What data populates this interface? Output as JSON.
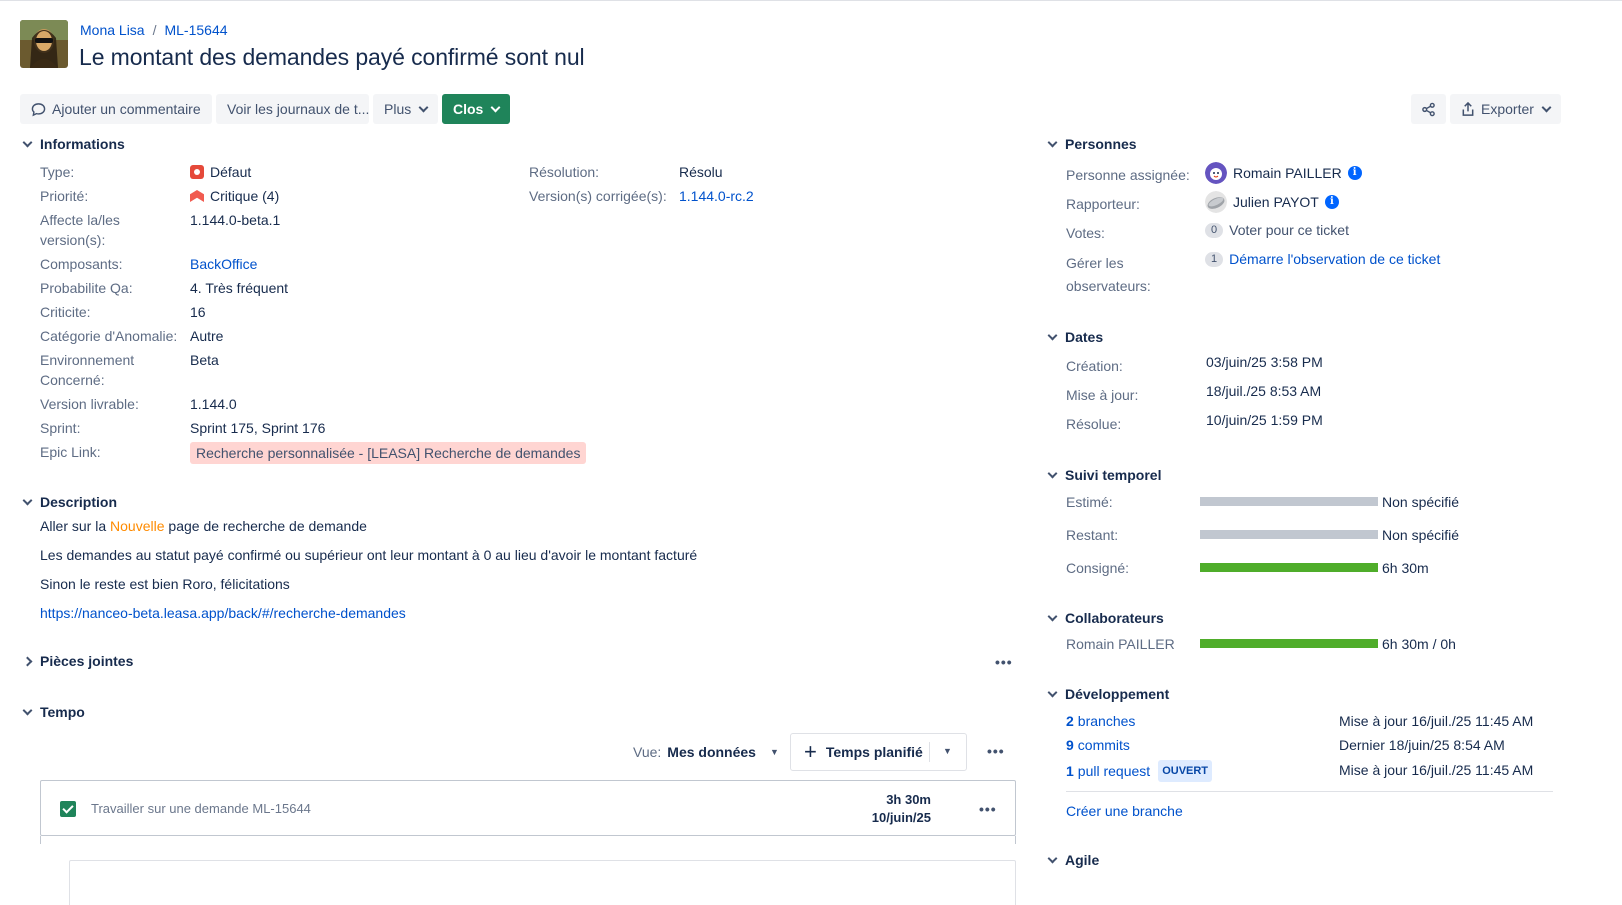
{
  "header": {
    "project": "Mona Lisa",
    "issue_key": "ML-15644",
    "title": "Le montant des demandes payé confirmé sont nul"
  },
  "toolbar": {
    "comment": "Ajouter un commentaire",
    "logs": "Voir les journaux de t...",
    "more": "Plus",
    "status": "Clos",
    "export": "Exporter"
  },
  "details": {
    "heading": "Informations",
    "type_label": "Type:",
    "type_value": "Défaut",
    "priority_label": "Priorité:",
    "priority_value": "Critique (4)",
    "affects_label": "Affecte la/les version(s):",
    "affects_value": "1.144.0-beta.1",
    "components_label": "Composants:",
    "components_value": "BackOffice",
    "proba_label": "Probabilite Qa:",
    "proba_value": "4. Très fréquent",
    "criticite_label": "Criticite:",
    "criticite_value": "16",
    "category_label": "Catégorie d'Anomalie:",
    "category_value": "Autre",
    "env_label": "Environnement Concerné:",
    "env_value": "Beta",
    "release_label": "Version livrable:",
    "release_value": "1.144.0",
    "sprint_label": "Sprint:",
    "sprint_value": "Sprint 175, Sprint 176",
    "epic_label": "Epic Link:",
    "epic_value": "Recherche personnalisée - [LEASA] Recherche de demandes",
    "resolution_label": "Résolution:",
    "resolution_value": "Résolu",
    "fix_label": "Version(s) corrigée(s):",
    "fix_value": "1.144.0-rc.2"
  },
  "description": {
    "heading": "Description",
    "line1_pre": "Aller sur la ",
    "line1_word": "Nouvelle",
    "line1_post": " page de recherche de demande",
    "line2": "Les demandes au statut payé confirmé ou supérieur ont leur montant à 0 au lieu d'avoir le montant facturé",
    "line3": "Sinon le reste est bien Roro, félicitations",
    "link": "https://nanceo-beta.leasa.app/back/#/recherche-demandes"
  },
  "attachments": {
    "heading": "Pièces jointes"
  },
  "tempo": {
    "heading": "Tempo",
    "view_label": "Vue:",
    "view_value": "Mes données",
    "planned": "Temps planifié",
    "worklog_desc": "Travailler sur une demande ML-15644",
    "worklog_time": "3h 30m",
    "worklog_date": "10/juin/25"
  },
  "people": {
    "heading": "Personnes",
    "assignee_label": "Personne assignée:",
    "assignee": "Romain PAILLER",
    "reporter_label": "Rapporteur:",
    "reporter": "Julien PAYOT",
    "votes_label": "Votes:",
    "votes_count": "0",
    "votes_link": "Voter pour ce ticket",
    "watchers_label": "Gérer les observateurs:",
    "watchers_count": "1",
    "watchers_link": "Démarre l'observation de ce ticket"
  },
  "dates": {
    "heading": "Dates",
    "created_label": "Création:",
    "created": "03/juin/25 3:58 PM",
    "updated_label": "Mise à jour:",
    "updated": "18/juil./25 8:53 AM",
    "resolved_label": "Résolue:",
    "resolved": "10/juin/25 1:59 PM"
  },
  "time_tracking": {
    "heading": "Suivi temporel",
    "estimated_label": "Estimé:",
    "estimated": "Non spécifié",
    "remaining_label": "Restant:",
    "remaining": "Non spécifié",
    "logged_label": "Consigné:",
    "logged": "6h 30m",
    "logged_fraction": 1.0
  },
  "collaborators": {
    "heading": "Collaborateurs",
    "name": "Romain PAILLER",
    "value": "6h 30m / 0h",
    "fraction": 1.0
  },
  "development": {
    "heading": "Développement",
    "branches_count": "2",
    "branches_label": "branches",
    "branches_status": "Mise à jour 16/juil./25 11:45 AM",
    "commits_count": "9",
    "commits_label": "commits",
    "commits_status": "Dernier 18/juin/25 8:54 AM",
    "pr_count": "1",
    "pr_label": "pull request",
    "pr_lozenge": "OUVERT",
    "pr_status": "Mise à jour 16/juil./25 11:45 AM",
    "create_branch": "Créer une branche"
  },
  "agile": {
    "heading": "Agile"
  },
  "colors": {
    "primary_status": "#1f845a",
    "link": "#0052cc",
    "bar_green": "#4fad2a",
    "bar_grey": "#c1c7d0",
    "epic_bg": "#ffd5d2"
  }
}
